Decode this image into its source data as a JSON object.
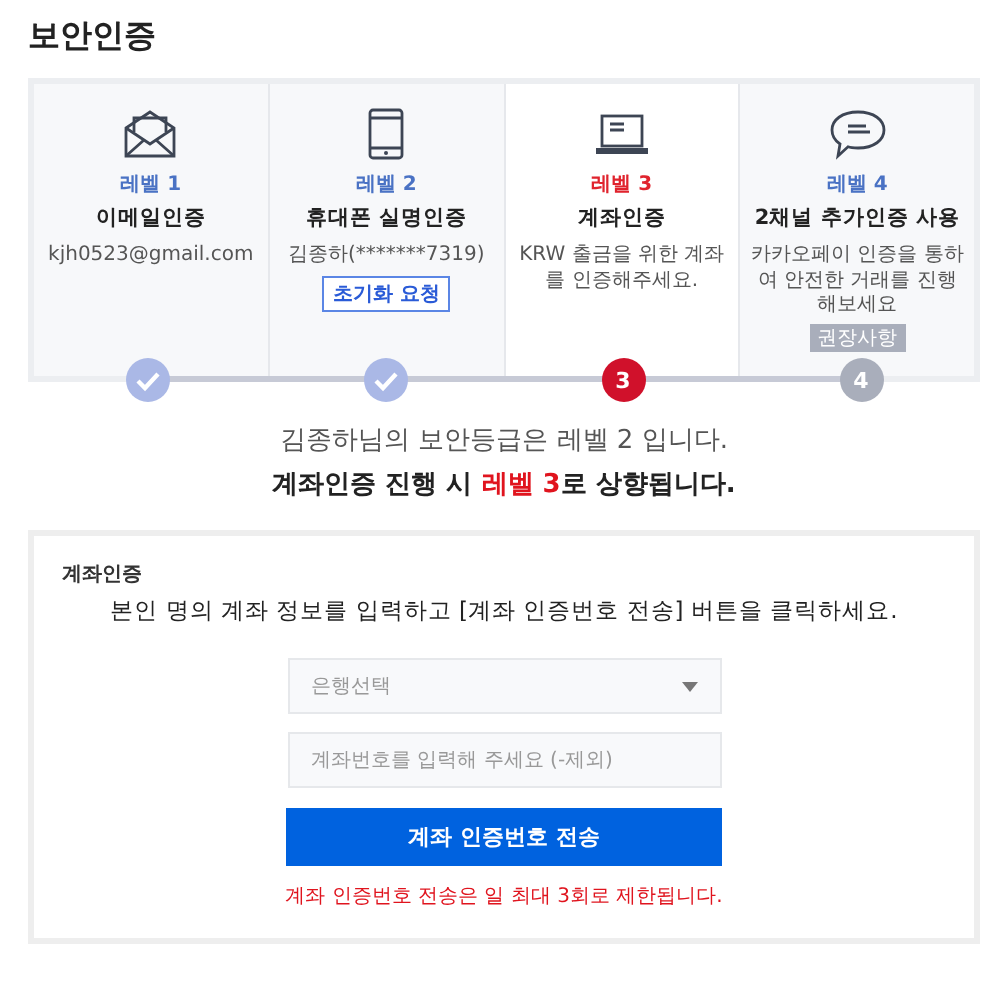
{
  "page_title": "보안인증",
  "steps": [
    {
      "level_label": "레벨 1",
      "title": "이메일인증",
      "detail": "kjh0523@gmail.com",
      "done": true,
      "selected": false
    },
    {
      "level_label": "레벨 2",
      "title": "휴대폰 실명인증",
      "detail": "김종하(*******7319)",
      "button": "초기화 요청",
      "done": true,
      "selected": false
    },
    {
      "level_label": "레벨 3",
      "title": "계좌인증",
      "detail": "KRW 출금을 위한 계좌를 인증해주세요.",
      "done": false,
      "selected": true,
      "marker": "3"
    },
    {
      "level_label": "레벨 4",
      "title": "2채널 추가인증 사용",
      "detail": "카카오페이 인증을 통하여 안전한 거래를 진행해보세요",
      "badge": "권장사항",
      "done": false,
      "selected": false,
      "marker": "4"
    }
  ],
  "summary": {
    "current": "김종하님의 보안등급은 레벨 2 입니다.",
    "upgrade_before": "계좌인증 진행 시 ",
    "upgrade_highlight": "레벨 3",
    "upgrade_after": "로 상향됩니다."
  },
  "form": {
    "title": "계좌인증",
    "instruction": "본인 명의 계좌 정보를 입력하고 [계좌 인증번호 전송] 버튼을 클릭하세요.",
    "bank_select": {
      "placeholder": "은행선택"
    },
    "account_input": {
      "placeholder": "계좌번호를 입력해 주세요 (-제외)"
    },
    "submit": "계좌 인증번호 전송",
    "notice": "계좌 인증번호 전송은 일 최대 3회로 제한됩니다."
  }
}
